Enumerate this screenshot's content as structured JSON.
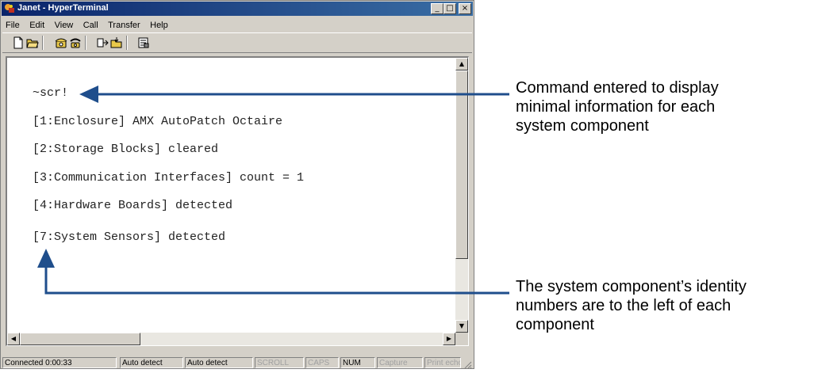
{
  "window": {
    "title": "Janet - HyperTerminal",
    "controls": {
      "minimize": "_",
      "maximize": "□",
      "close": "×"
    }
  },
  "menu": [
    "File",
    "Edit",
    "View",
    "Call",
    "Transfer",
    "Help"
  ],
  "toolbar": {
    "icons": [
      "new-document-icon",
      "open-folder-icon",
      "call-icon",
      "disconnect-icon",
      "send-icon",
      "receive-icon",
      "properties-icon"
    ]
  },
  "terminal": {
    "lines": [
      "~scr!",
      "[1:Enclosure] AMX AutoPatch Octaire",
      "[2:Storage Blocks] cleared",
      "[3:Communication Interfaces] count = 1",
      "[4:Hardware Boards] detected",
      "[7:System Sensors] detected"
    ]
  },
  "statusbar": {
    "connected": "Connected 0:00:33",
    "detect1": "Auto detect",
    "detect2": "Auto detect",
    "scroll": "SCROLL",
    "caps": "CAPS",
    "num": "NUM",
    "capture": "Capture",
    "print": "Print echo"
  },
  "annotations": {
    "command": [
      "Command entered to display",
      "minimal information for each",
      "system component"
    ],
    "identity": [
      "The system component’s identity",
      "numbers are to the left of each",
      "component"
    ],
    "arrow_color": "#1f4e8c"
  }
}
